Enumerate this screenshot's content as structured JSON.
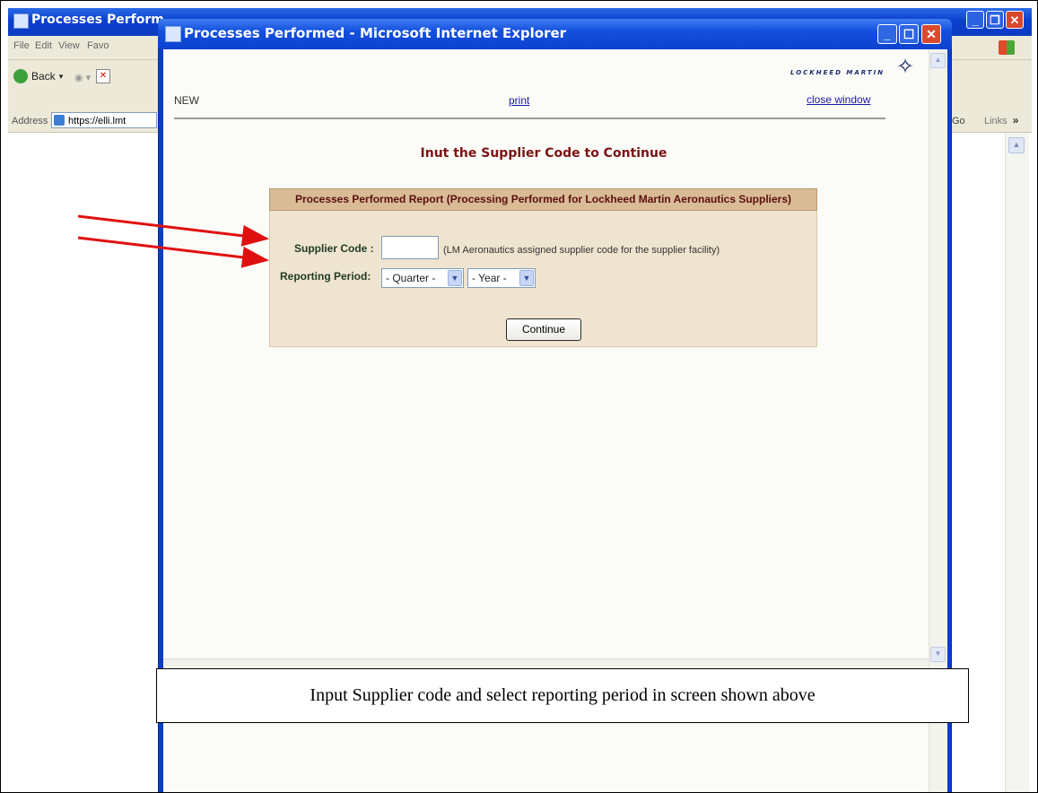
{
  "background_window": {
    "title": "Processes Perform",
    "menu": [
      "File",
      "Edit",
      "View",
      "Favo"
    ],
    "back_label": "Back",
    "address_label": "Address",
    "address_value": "https://elli.lmt",
    "go_label": "Go",
    "links_label": "Links"
  },
  "popup": {
    "title": "Processes Performed - Microsoft Internet Explorer",
    "logo_text": "LOCKHEED MARTIN",
    "new_label": "NEW",
    "print_label": "print",
    "close_label": "close window",
    "heading": "Inut the Supplier Code to Continue",
    "form": {
      "header": "Processes Performed Report (Processing Performed for Lockheed Martin Aeronautics Suppliers)",
      "supplier_label": "Supplier Code :",
      "supplier_value": "",
      "supplier_hint": "(LM Aeronautics assigned supplier code for the supplier facility)",
      "period_label": "Reporting Period:",
      "quarter_selected": "- Quarter -",
      "year_selected": "- Year -",
      "continue_label": "Continue"
    }
  },
  "caption": "Input Supplier code and select reporting period in screen shown above",
  "colors": {
    "title_bar": "#0c41cf",
    "heading": "#7a1414",
    "form_header_bg": "#d9bc95",
    "form_bg": "#efe4cf",
    "arrow": "#e01010"
  }
}
